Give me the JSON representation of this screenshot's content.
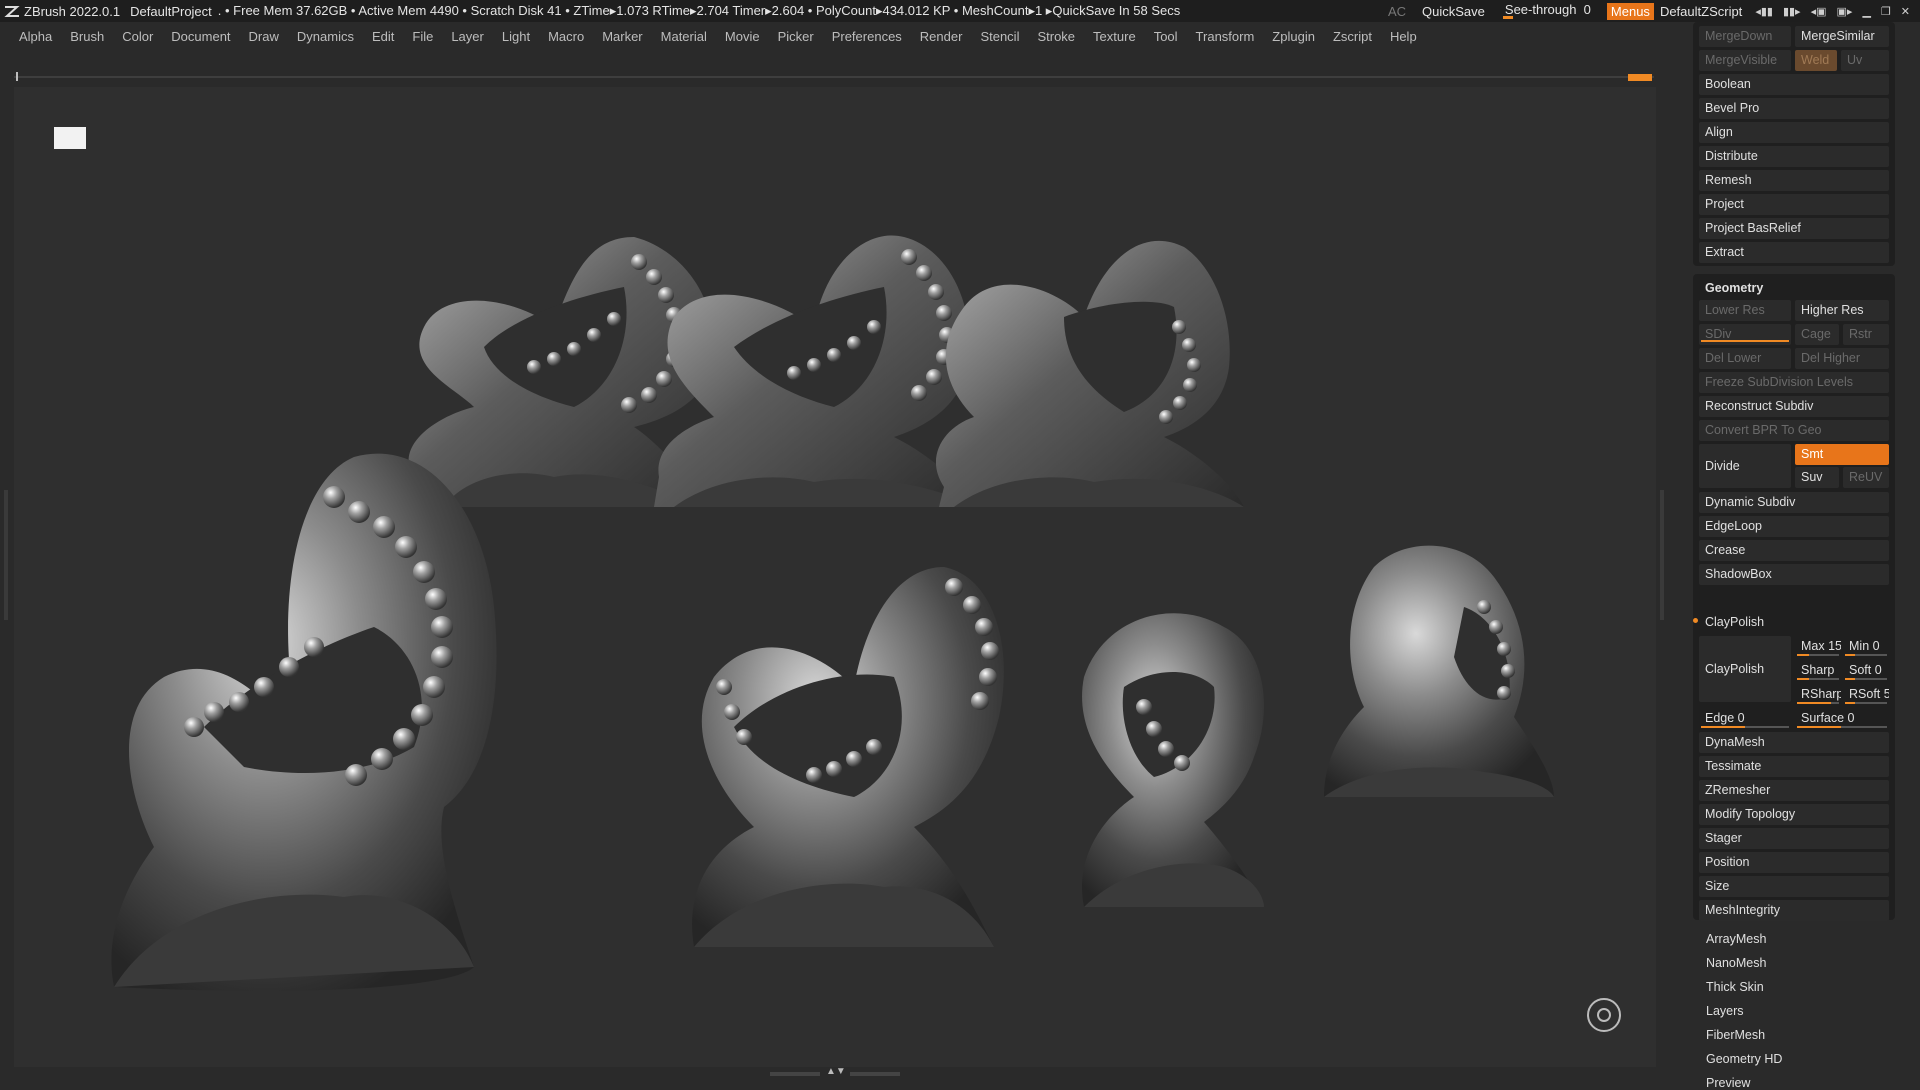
{
  "titlebar": {
    "app": "ZBrush 2022.0.1",
    "project": "DefaultProject",
    "status": ". • Free Mem 37.62GB • Active Mem 4490 • Scratch Disk 41 •  ZTime▸1.073 RTime▸2.704 Timer▸2.604 • PolyCount▸434.012 KP  • MeshCount▸1  ▸QuickSave In 58 Secs",
    "ac": "AC",
    "quicksave": "QuickSave",
    "seethrough_label": "See-through",
    "seethrough_value": "0",
    "menus": "Menus",
    "script": "DefaultZScript"
  },
  "menubar": [
    "Alpha",
    "Brush",
    "Color",
    "Document",
    "Draw",
    "Dynamics",
    "Edit",
    "File",
    "Layer",
    "Light",
    "Macro",
    "Marker",
    "Material",
    "Movie",
    "Picker",
    "Preferences",
    "Render",
    "Stencil",
    "Stroke",
    "Texture",
    "Tool",
    "Transform",
    "Zplugin",
    "Zscript",
    "Help"
  ],
  "panel": {
    "merge_down": "MergeDown",
    "merge_similar": "MergeSimilar",
    "merge_visible": "MergeVisible",
    "weld": "Weld",
    "uv": "Uv",
    "top_items": [
      "Boolean",
      "Bevel Pro",
      "Align",
      "Distribute",
      "Remesh",
      "Project",
      "Project BasRelief",
      "Extract"
    ],
    "geometry_title": "Geometry",
    "lower_res": "Lower Res",
    "higher_res": "Higher Res",
    "sdiv": "SDiv",
    "cage": "Cage",
    "rstr": "Rstr",
    "del_lower": "Del Lower",
    "del_higher": "Del Higher",
    "freeze": "Freeze SubDivision Levels",
    "reconstruct": "Reconstruct Subdiv",
    "convert_bpr": "Convert BPR To Geo",
    "divide": "Divide",
    "smt": "Smt",
    "suv": "Suv",
    "reuv": "ReUV",
    "mid_items": [
      "Dynamic Subdiv",
      "EdgeLoop",
      "Crease",
      "ShadowBox"
    ],
    "claypolish_header": "ClayPolish",
    "claypolish_btn": "ClayPolish",
    "max": "Max 15",
    "min": "Min 0",
    "sharp": "Sharp",
    "soft": "Soft 0",
    "rsharp": "RSharp",
    "rsoft": "RSoft 5",
    "edge": "Edge 0",
    "surface": "Surface 0",
    "lower_items": [
      "DynaMesh",
      "Tessimate",
      "ZRemesher",
      "Modify Topology",
      "Stager",
      "Position",
      "Size",
      "MeshIntegrity"
    ],
    "sub_items": [
      "ArrayMesh",
      "NanoMesh",
      "Thick Skin",
      "Layers",
      "FiberMesh",
      "Geometry HD",
      "Preview"
    ]
  }
}
